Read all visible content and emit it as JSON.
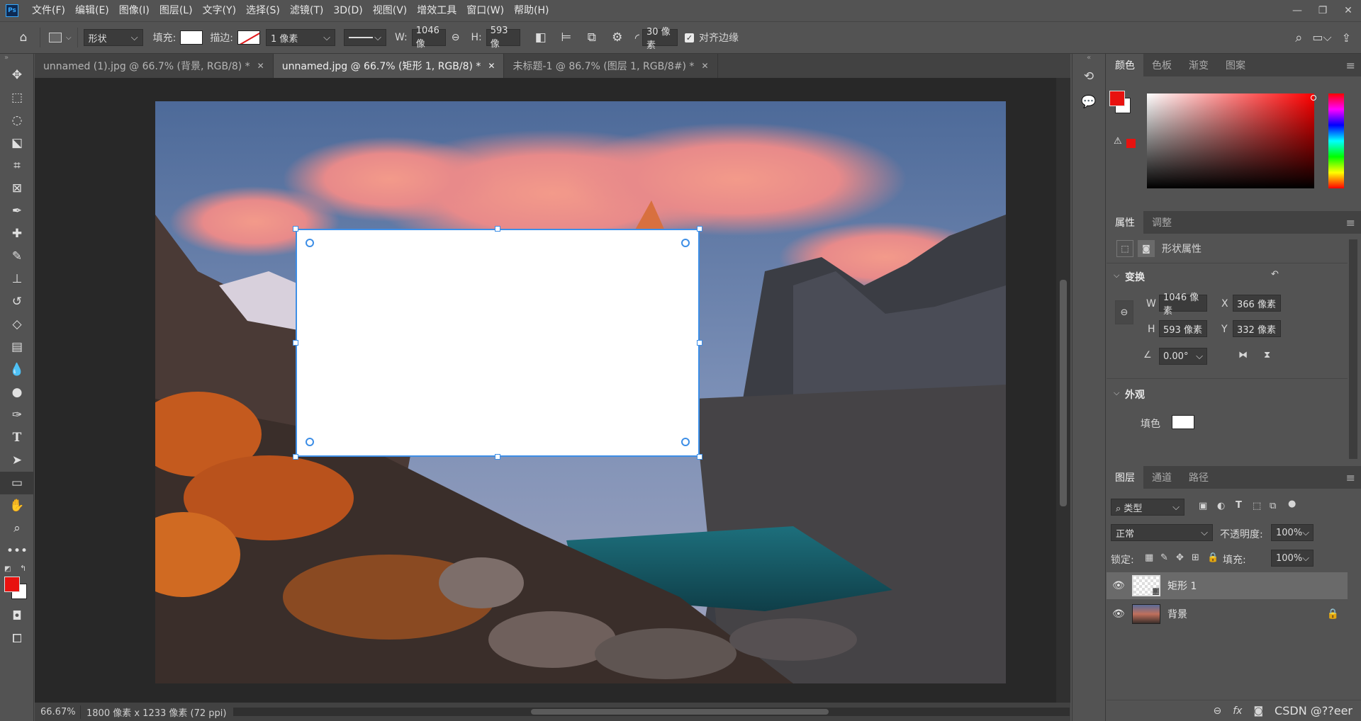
{
  "menubar": {
    "logo": "Ps",
    "items": [
      "文件(F)",
      "编辑(E)",
      "图像(I)",
      "图层(L)",
      "文字(Y)",
      "选择(S)",
      "滤镜(T)",
      "3D(D)",
      "视图(V)",
      "增效工具",
      "窗口(W)",
      "帮助(H)"
    ]
  },
  "options": {
    "mode": "形状",
    "fill_label": "填充:",
    "stroke_label": "描边:",
    "stroke_width": "1 像素",
    "w_label": "W:",
    "w_value": "1046 像",
    "h_label": "H:",
    "h_value": "593 像",
    "radius_value": "30 像素",
    "align_edges": "对齐边缘"
  },
  "tabs": [
    {
      "label": "unnamed (1).jpg @ 66.7% (背景, RGB/8) *"
    },
    {
      "label": "unnamed.jpg @ 66.7% (矩形 1, RGB/8) *"
    },
    {
      "label": "未标题-1 @ 86.7% (图层 1, RGB/8#) *"
    }
  ],
  "status": {
    "zoom": "66.67%",
    "doc_info": "1800 像素 x 1233 像素 (72 ppi)"
  },
  "color_panel": {
    "tabs": [
      "颜色",
      "色板",
      "渐变",
      "图案"
    ]
  },
  "properties_panel": {
    "tabs": [
      "属性",
      "调整"
    ],
    "header": "形状属性",
    "transform_title": "变换",
    "w_label": "W",
    "w_value": "1046 像素",
    "x_label": "X",
    "x_value": "366 像素",
    "h_label": "H",
    "h_value": "593 像素",
    "y_label": "Y",
    "y_value": "332 像素",
    "angle": "0.00°",
    "appearance_title": "外观",
    "fill_label": "填色"
  },
  "layers_panel": {
    "tabs": [
      "图层",
      "通道",
      "路径"
    ],
    "filter_kind": "类型",
    "blend_mode": "正常",
    "opacity_label": "不透明度:",
    "opacity_value": "100%",
    "lock_label": "锁定:",
    "fill_label": "填充:",
    "fill_value": "100%",
    "layers": [
      {
        "name": "矩形 1"
      },
      {
        "name": "背景"
      }
    ],
    "watermark": "CSDN @??eer"
  },
  "colors": {
    "foreground": "#e8120f",
    "accent": "#3d8ee6"
  }
}
